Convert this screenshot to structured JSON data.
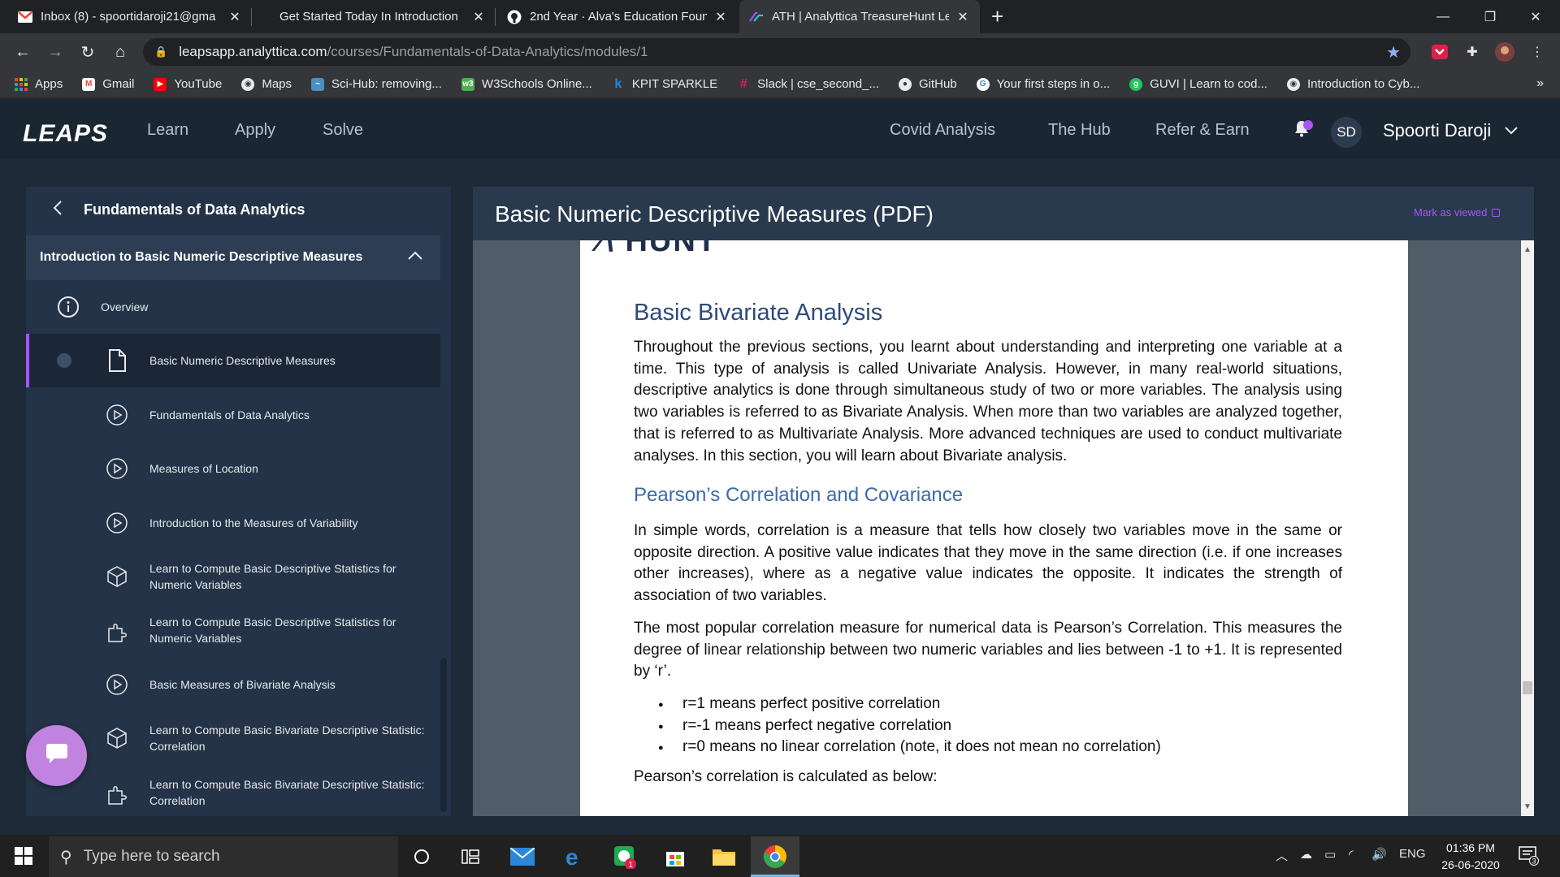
{
  "browser": {
    "tabs": [
      {
        "title": "Inbox (8) - spoortidaroji21@gma",
        "icon": "gmail-icon"
      },
      {
        "title": "Get Started Today In Introduction",
        "icon": "none"
      },
      {
        "title": "2nd Year · Alva's Education Foun",
        "icon": "github-icon"
      },
      {
        "title": "ATH | Analyttica TreasureHunt Le",
        "icon": "leaps-icon"
      }
    ],
    "url_host": "leapsapp.analyttica.com",
    "url_path": "/courses/Fundamentals-of-Data-Analytics/modules/1",
    "bookmarks": [
      {
        "label": "Apps",
        "color": "#ea4335"
      },
      {
        "label": "Gmail",
        "color": "#ea4335"
      },
      {
        "label": "YouTube",
        "color": "#ff0000"
      },
      {
        "label": "Maps",
        "color": "#e8eaed"
      },
      {
        "label": "Sci-Hub: removing...",
        "color": "#4a90c2"
      },
      {
        "label": "W3Schools Online...",
        "color": "#4caf50"
      },
      {
        "label": "KPIT SPARKLE",
        "color": "#1e88e5"
      },
      {
        "label": "Slack | cse_second_...",
        "color": "#e01e5a"
      },
      {
        "label": "GitHub",
        "color": "#e8eaed"
      },
      {
        "label": "Your first steps in o...",
        "color": "#e8eaed"
      },
      {
        "label": "GUVI | Learn to cod...",
        "color": "#22c55e"
      },
      {
        "label": "Introduction to Cyb...",
        "color": "#e8eaed"
      }
    ]
  },
  "header": {
    "logo": "LEAPS",
    "nav": [
      "Learn",
      "Apply",
      "Solve"
    ],
    "right_nav": [
      "Covid Analysis",
      "The Hub",
      "Refer & Earn"
    ],
    "initials": "SD",
    "user_name": "Spoorti Daroji",
    "accent": "#a855f7"
  },
  "sidebar": {
    "course_title": "Fundamentals of Data Analytics",
    "section_title": "Introduction to Basic Numeric Descriptive Measures",
    "items": [
      {
        "label": "Overview",
        "icon": "info-icon"
      },
      {
        "label": "Basic Numeric Descriptive Measures",
        "icon": "document-icon"
      },
      {
        "label": "Fundamentals of Data Analytics",
        "icon": "play-icon"
      },
      {
        "label": "Measures of Location",
        "icon": "play-icon"
      },
      {
        "label": "Introduction to the Measures of Variability",
        "icon": "play-icon"
      },
      {
        "label": "Learn to Compute Basic Descriptive Statistics for Numeric Variables",
        "icon": "cube-icon"
      },
      {
        "label": "Learn to Compute Basic Descriptive Statistics for Numeric Variables",
        "icon": "puzzle-icon"
      },
      {
        "label": "Basic Measures of Bivariate Analysis",
        "icon": "play-icon"
      },
      {
        "label": "Learn to Compute Basic Bivariate Descriptive Statistic: Correlation",
        "icon": "cube-icon"
      },
      {
        "label": "Learn to Compute Basic Bivariate Descriptive Statistic: Correlation",
        "icon": "puzzle-icon"
      }
    ]
  },
  "main": {
    "title": "Basic Numeric Descriptive Measures (PDF)",
    "mark_viewed": "Mark as viewed",
    "pdf": {
      "brand": "HUNT",
      "h1": "Basic Bivariate Analysis",
      "p1": "Throughout the previous sections, you learnt about understanding and interpreting one variable at a time. This type of analysis is called Univariate Analysis. However, in many real-world situations, descriptive analytics is done through simultaneous study of two or more variables. The analysis using two variables is referred to as Bivariate Analysis. When more than two variables are analyzed together, that is referred to as Multivariate Analysis. More advanced techniques are used to conduct multivariate analyses. In this section, you will learn about Bivariate analysis.",
      "h2": "Pearson’s Correlation and Covariance",
      "p2": "In simple words, correlation is a measure that tells how closely two variables move in the same or opposite direction. A positive value indicates that they move in the same direction (i.e. if one increases other increases), where as a negative value indicates the opposite. It indicates the strength of association of two variables.",
      "p3": "The most popular correlation measure for numerical data is Pearson’s Correlation. This measures the degree of linear relationship between two numeric variables and lies between -1 to +1. It is represented by ‘r’.",
      "bullets": [
        "r=1 means perfect positive correlation",
        "r=-1 means perfect negative correlation",
        "r=0 means no linear correlation (note, it does not mean no correlation)"
      ],
      "p4": "Pearson’s correlation is calculated as below:"
    }
  },
  "taskbar": {
    "search_placeholder": "Type here to search",
    "language": "ENG",
    "time": "01:36 PM",
    "date": "26-06-2020",
    "notification_count": "3",
    "badge_count": "1"
  }
}
